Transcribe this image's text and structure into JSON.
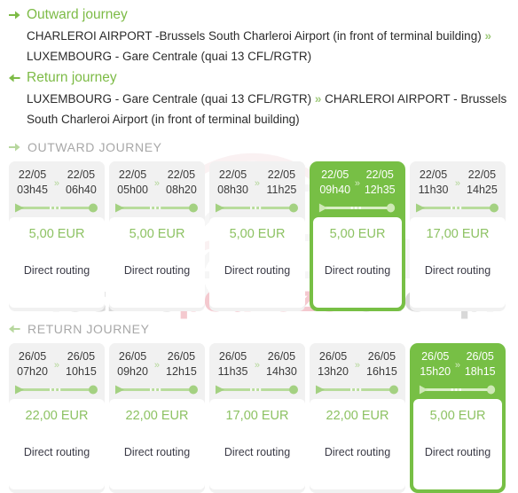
{
  "summary": {
    "outward": {
      "title": "Outward journey",
      "arrow_icon": "arrow-right-icon",
      "from": "CHARLEROI AIRPORT -Brussels South Charleroi Airport (in front of terminal building)",
      "separator": "»",
      "to": "LUXEMBOURG - Gare Centrale (quai 13 CFL/RGTR)"
    },
    "return": {
      "title": "Return journey",
      "arrow_icon": "arrow-left-icon",
      "from": "LUXEMBOURG - Gare Centrale (quai 13 CFL/RGTR)",
      "separator": "»",
      "to": "CHARLEROI AIRPORT - Brussels South Charleroi Airport (in front of terminal building)"
    }
  },
  "sections": [
    {
      "id": "outward-journey",
      "label": "OUTWARD JOURNEY",
      "arrow_icon": "arrow-right-icon",
      "cards": [
        {
          "depart_date": "22/05",
          "depart_time": "03h45",
          "arrive_date": "22/05",
          "arrive_time": "06h40",
          "separator": "»",
          "price": "5,00 EUR",
          "routing": "Direct routing",
          "selected": false
        },
        {
          "depart_date": "22/05",
          "depart_time": "05h00",
          "arrive_date": "22/05",
          "arrive_time": "08h20",
          "separator": "»",
          "price": "5,00 EUR",
          "routing": "Direct routing",
          "selected": false
        },
        {
          "depart_date": "22/05",
          "depart_time": "08h30",
          "arrive_date": "22/05",
          "arrive_time": "11h25",
          "separator": "»",
          "price": "5,00 EUR",
          "routing": "Direct routing",
          "selected": false
        },
        {
          "depart_date": "22/05",
          "depart_time": "09h40",
          "arrive_date": "22/05",
          "arrive_time": "12h35",
          "separator": "»",
          "price": "5,00 EUR",
          "routing": "Direct routing",
          "selected": true
        },
        {
          "depart_date": "22/05",
          "depart_time": "11h30",
          "arrive_date": "22/05",
          "arrive_time": "14h25",
          "separator": "»",
          "price": "17,00 EUR",
          "routing": "Direct routing",
          "selected": false
        }
      ]
    },
    {
      "id": "return-journey",
      "label": "RETURN JOURNEY",
      "arrow_icon": "arrow-left-icon",
      "cards": [
        {
          "depart_date": "26/05",
          "depart_time": "07h20",
          "arrive_date": "26/05",
          "arrive_time": "10h15",
          "separator": "»",
          "price": "22,00 EUR",
          "routing": "Direct routing",
          "selected": false
        },
        {
          "depart_date": "26/05",
          "depart_time": "09h20",
          "arrive_date": "26/05",
          "arrive_time": "12h15",
          "separator": "»",
          "price": "22,00 EUR",
          "routing": "Direct routing",
          "selected": false
        },
        {
          "depart_date": "26/05",
          "depart_time": "11h35",
          "arrive_date": "26/05",
          "arrive_time": "14h30",
          "separator": "»",
          "price": "17,00 EUR",
          "routing": "Direct routing",
          "selected": false
        },
        {
          "depart_date": "26/05",
          "depart_time": "13h20",
          "arrive_date": "26/05",
          "arrive_time": "16h15",
          "separator": "»",
          "price": "22,00 EUR",
          "routing": "Direct routing",
          "selected": false
        },
        {
          "depart_date": "26/05",
          "depart_time": "15h20",
          "arrive_date": "26/05",
          "arrive_time": "18h15",
          "separator": "»",
          "price": "5,00 EUR",
          "routing": "Direct routing",
          "selected": true
        }
      ]
    }
  ],
  "watermark": {
    "part_a": "mleczne",
    "part_b": "podroze",
    "part_c": ".onet.pl",
    "icon": "car-watermark-icon"
  },
  "colors": {
    "accent_green": "#7dbb46",
    "selected_green": "#77bf45",
    "price_green": "#8dc263",
    "card_grey": "#f1f1f1",
    "section_label_grey": "#a8a8a8",
    "watermark_grey": "#d8d8d8",
    "watermark_pink": "#f4c9cf"
  }
}
